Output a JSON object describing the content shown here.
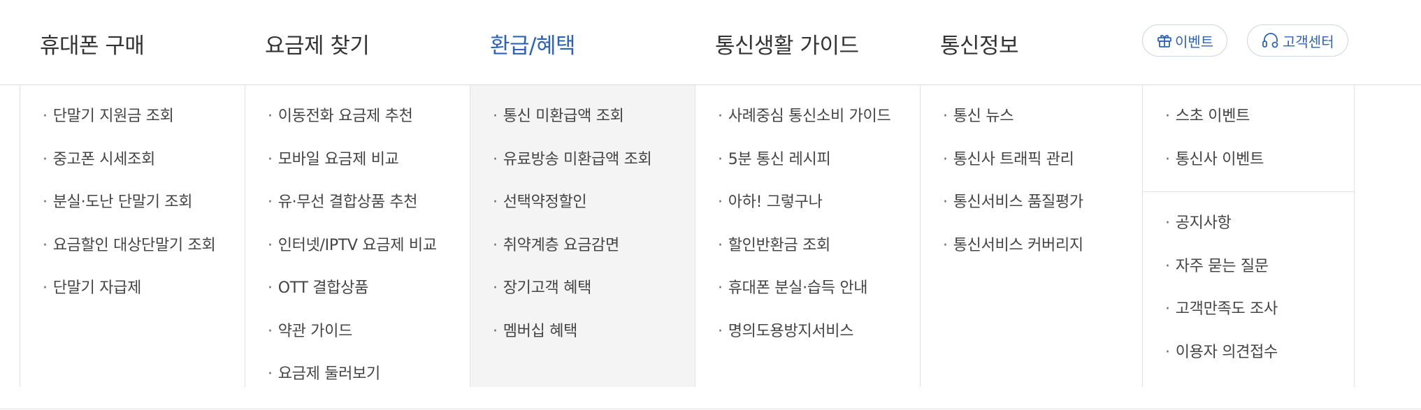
{
  "nav": {
    "items": [
      {
        "label": "휴대폰 구매"
      },
      {
        "label": "요금제 찾기"
      },
      {
        "label": "환급/혜택"
      },
      {
        "label": "통신생활 가이드"
      },
      {
        "label": "통신정보"
      }
    ],
    "event_button": "이벤트",
    "support_button": "고객센터",
    "accent_color": "#2c64b8",
    "icons": [
      "gift-icon",
      "headset-icon"
    ]
  },
  "menu": {
    "columns": [
      {
        "items": [
          "단말기 지원금 조회",
          "중고폰 시세조회",
          "분실·도난 단말기 조회",
          "요금할인 대상단말기 조회",
          "단말기 자급제"
        ]
      },
      {
        "items": [
          "이동전화 요금제 추천",
          "모바일 요금제 비교",
          "유·무선 결합상품 추천",
          "인터넷/IPTV 요금제 비교",
          "OTT 결합상품",
          "약관 가이드",
          "요금제 둘러보기"
        ]
      },
      {
        "items": [
          "통신 미환급액 조회",
          "유료방송 미환급액 조회",
          "선택약정할인",
          "취약계층 요금감면",
          "장기고객 혜택",
          "멤버십 혜택"
        ]
      },
      {
        "items": [
          "사례중심 통신소비 가이드",
          "5분 통신 레시피",
          "아하! 그렇구나",
          "할인반환금 조회",
          "휴대폰 분실·습득 안내",
          "명의도용방지서비스"
        ]
      },
      {
        "items": [
          "통신 뉴스",
          "통신사 트래픽 관리",
          "통신서비스 품질평가",
          "통신서비스 커버리지"
        ]
      }
    ],
    "extra": {
      "top": [
        "스초 이벤트",
        "통신사 이벤트"
      ],
      "bottom": [
        "공지사항",
        "자주 묻는 질문",
        "고객만족도 조사",
        "이용자 의견접수"
      ]
    }
  }
}
